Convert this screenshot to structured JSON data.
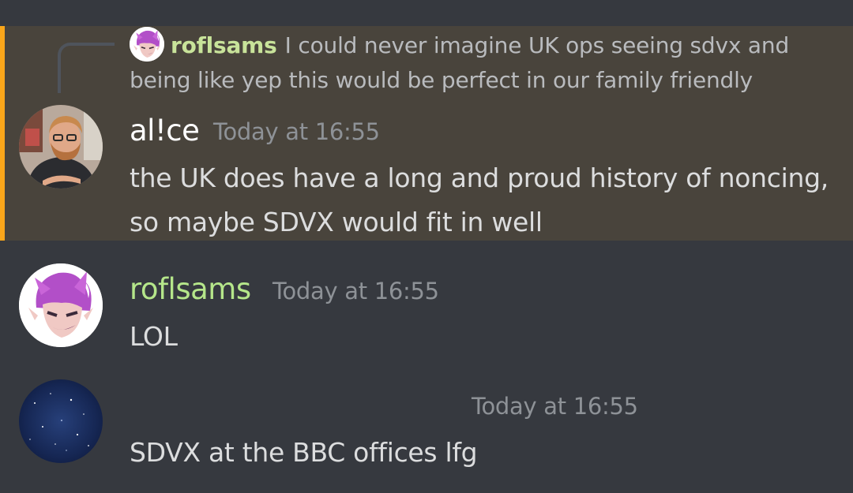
{
  "reply": {
    "author": "roflsams",
    "text": "I could never imagine UK ops seeing sdvx and being like yep this would be perfect in our family friendly"
  },
  "messages": [
    {
      "author": "al!ce",
      "timestamp": "Today at 16:55",
      "lines": [
        "the UK does have a long and proud history of noncing,",
        "so maybe SDVX would fit in well"
      ],
      "highlighted": true
    },
    {
      "author": "roflsams",
      "timestamp": "Today at 16:55",
      "lines": [
        "LOL"
      ]
    },
    {
      "author": "",
      "timestamp": "Today at 16:55",
      "lines": [
        "SDVX at the BBC offices lfg"
      ]
    }
  ],
  "colors": {
    "background": "#36393f",
    "mention_highlight": "#49443c",
    "mention_bar": "#faa61a",
    "roflsams_name": "#b5e68a",
    "alice_name": "#ffffff",
    "timestamp": "#8e9297",
    "message_text": "#dcddde"
  },
  "icons": {
    "roflsams_avatar": "purple-haired-character-avatar",
    "alice_avatar": "bearded-man-photo-avatar",
    "third_user_avatar": "starry-night-sky-avatar"
  }
}
